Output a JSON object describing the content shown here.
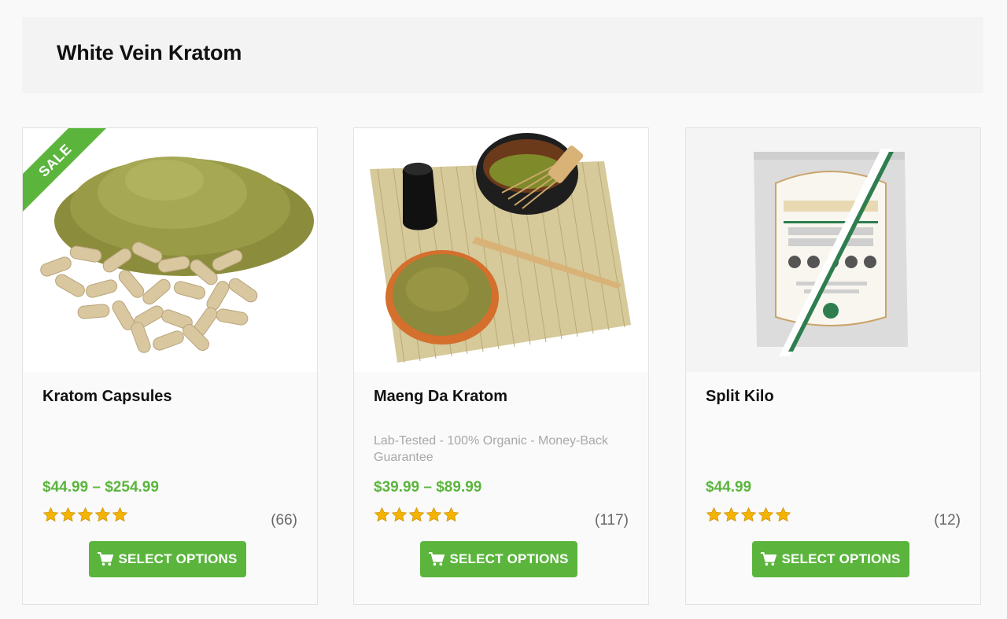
{
  "page": {
    "title": "White Vein Kratom"
  },
  "colors": {
    "accent": "#5bb53d",
    "price": "#5bb53d",
    "star": "#f5b301",
    "muted_text": "#a8a8a8"
  },
  "products": [
    {
      "name": "Kratom Capsules",
      "badge": "SALE",
      "description": "",
      "price": "$44.99 – $254.99",
      "rating": 5,
      "reviews": "(66)",
      "button_label": "SELECT OPTIONS",
      "button_icon": "cart-icon",
      "image": "kratom-powder-and-capsules-image"
    },
    {
      "name": "Maeng Da Kratom",
      "description": "Lab-Tested - 100% Organic - Money-Back Guarantee",
      "price": "$39.99 – $89.99",
      "rating": 5,
      "reviews": "(117)",
      "button_label": "SELECT OPTIONS",
      "button_icon": "cart-icon",
      "image": "powder-bowl-on-bamboo-mat-image"
    },
    {
      "name": "Split Kilo",
      "description": "",
      "price": "$44.99",
      "rating": 5,
      "reviews": "(12)",
      "button_label": "SELECT OPTIONS",
      "button_icon": "cart-icon",
      "image": "kratom-bag-split-image"
    }
  ]
}
